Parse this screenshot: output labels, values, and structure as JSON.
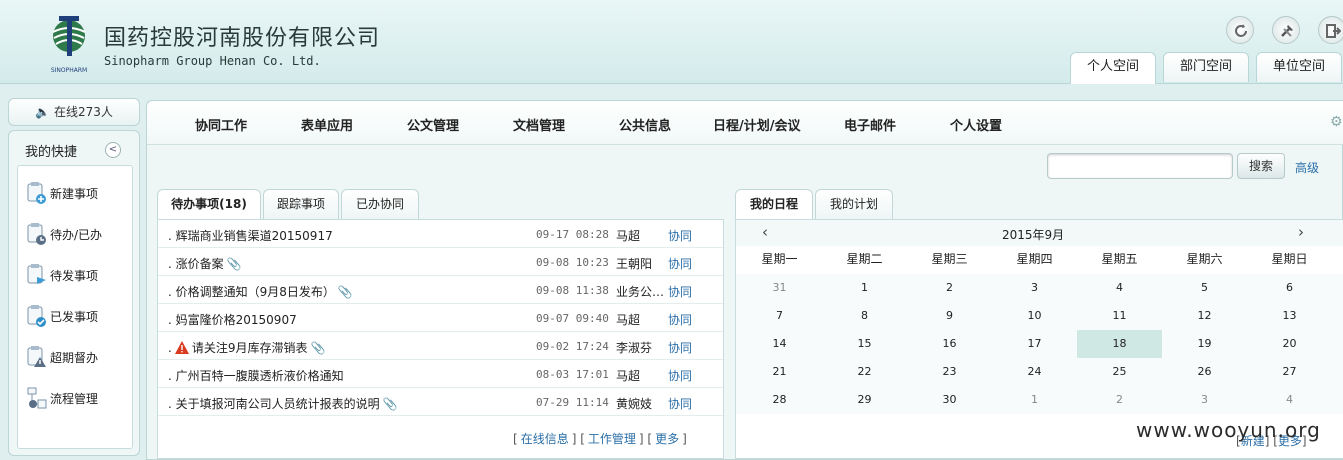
{
  "header": {
    "brand_cn": "国药控股河南股份有限公司",
    "brand_en": "Sinopharm Group Henan Co. Ltd.",
    "logo_text": "SINOPHARM",
    "icons": [
      "refresh-icon",
      "tools-icon",
      "logout-icon"
    ],
    "space_tabs": [
      "个人空间",
      "部门空间",
      "单位空间"
    ],
    "active_space_tab": "个人空间"
  },
  "sidebar": {
    "online": "在线273人",
    "title": "我的快捷",
    "items": [
      {
        "label": "新建事项",
        "icon": "new-item-icon"
      },
      {
        "label": "待办/已办",
        "icon": "pending-icon"
      },
      {
        "label": "待发事项",
        "icon": "to-send-icon"
      },
      {
        "label": "已发事项",
        "icon": "sent-icon"
      },
      {
        "label": "超期督办",
        "icon": "overdue-icon"
      },
      {
        "label": "流程管理",
        "icon": "process-icon"
      }
    ]
  },
  "menu": [
    "协同工作",
    "表单应用",
    "公文管理",
    "文档管理",
    "公共信息",
    "日程/计划/会议",
    "电子邮件",
    "个人设置"
  ],
  "search": {
    "button": "搜索",
    "advanced": "高级",
    "placeholder": ""
  },
  "todo": {
    "tabs": [
      "待办事项(18)",
      "跟踪事项",
      "已办协同"
    ],
    "rows": [
      {
        "title": ". 辉瑞商业销售渠道20150917",
        "attach": false,
        "warn": false,
        "date": "09-17 08:28",
        "person": "马超",
        "action": "协同"
      },
      {
        "title": ". 涨价备案",
        "attach": true,
        "warn": false,
        "date": "09-08 10:23",
        "person": "王朝阳",
        "action": "协同"
      },
      {
        "title": ". 价格调整通知（9月8日发布）",
        "attach": true,
        "warn": false,
        "date": "09-08 11:38",
        "person": "业务公…",
        "action": "协同"
      },
      {
        "title": ". 妈富隆价格20150907",
        "attach": false,
        "warn": false,
        "date": "09-07 09:40",
        "person": "马超",
        "action": "协同"
      },
      {
        "title": "请关注9月库存滞销表",
        "prefix": ".",
        "attach": true,
        "warn": true,
        "date": "09-02 17:24",
        "person": "李淑芬",
        "action": "协同"
      },
      {
        "title": ". 广州百特一腹膜透析液价格通知",
        "attach": false,
        "warn": false,
        "date": "08-03 17:01",
        "person": "马超",
        "action": "协同"
      },
      {
        "title": ". 关于填报河南公司人员统计报表的说明",
        "attach": true,
        "warn": false,
        "date": "07-29 11:14",
        "person": "黄婉妓",
        "action": "协同"
      }
    ],
    "footer_links": [
      "在线信息",
      "工作管理",
      "更多"
    ]
  },
  "calendar": {
    "tabs": [
      "我的日程",
      "我的计划"
    ],
    "month": "2015年9月",
    "prev": "‹",
    "next": "›",
    "weekdays": [
      "星期一",
      "星期二",
      "星期三",
      "星期四",
      "星期五",
      "星期六",
      "星期日"
    ],
    "weeks": [
      [
        "31",
        "1",
        "2",
        "3",
        "4",
        "5",
        "6"
      ],
      [
        "7",
        "8",
        "9",
        "10",
        "11",
        "12",
        "13"
      ],
      [
        "14",
        "15",
        "16",
        "17",
        "18",
        "19",
        "20"
      ],
      [
        "21",
        "22",
        "23",
        "24",
        "25",
        "26",
        "27"
      ],
      [
        "28",
        "29",
        "30",
        "1",
        "2",
        "3",
        "4"
      ]
    ],
    "other_month": [
      [
        0,
        0
      ],
      [
        4,
        3
      ],
      [
        4,
        4
      ],
      [
        4,
        5
      ],
      [
        4,
        6
      ]
    ],
    "today": [
      2,
      4
    ],
    "footer_links": [
      "新建",
      "更多"
    ]
  },
  "watermark": "www.wooyun.org",
  "colors": {
    "link": "#2b6fa8",
    "today": "#cfe8e4",
    "header_bg": "#e9f6f6"
  }
}
